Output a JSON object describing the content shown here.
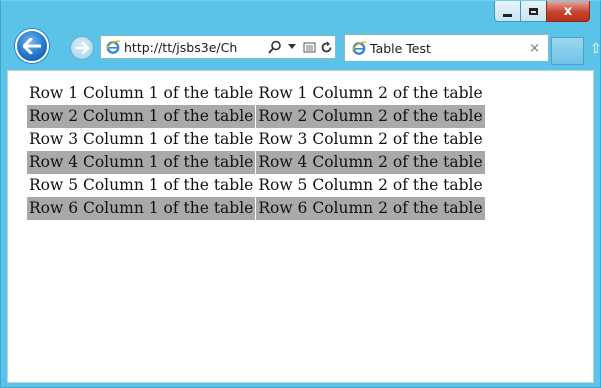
{
  "window": {
    "caption_buttons": {
      "minimize": "minimize",
      "maximize": "maximize",
      "close": "x"
    }
  },
  "nav": {
    "back_icon": "back-arrow-icon",
    "forward_icon": "forward-arrow-icon",
    "address": "http://tt/jsbs3e/Ch",
    "address_tools": [
      "search-icon",
      "dropdown-icon",
      "compat-view-icon",
      "refresh-icon"
    ]
  },
  "tab": {
    "title": "Table Test",
    "close": "×"
  },
  "table": {
    "rows": [
      {
        "c1": "Row 1 Column 1 of the table",
        "c2": "Row 1 Column 2 of the table"
      },
      {
        "c1": "Row 2 Column 1 of the table",
        "c2": "Row 2 Column 2 of the table"
      },
      {
        "c1": "Row 3 Column 1 of the table",
        "c2": "Row 3 Column 2 of the table"
      },
      {
        "c1": "Row 4 Column 1 of the table",
        "c2": "Row 4 Column 2 of the table"
      },
      {
        "c1": "Row 5 Column 1 of the table",
        "c2": "Row 5 Column 2 of the table"
      },
      {
        "c1": "Row 6 Column 1 of the table",
        "c2": "Row 6 Column 2 of the table"
      }
    ]
  },
  "colors": {
    "frame": "#5cc3e8",
    "row_highlight": "#a9a9a9",
    "close": "#c7432f"
  }
}
